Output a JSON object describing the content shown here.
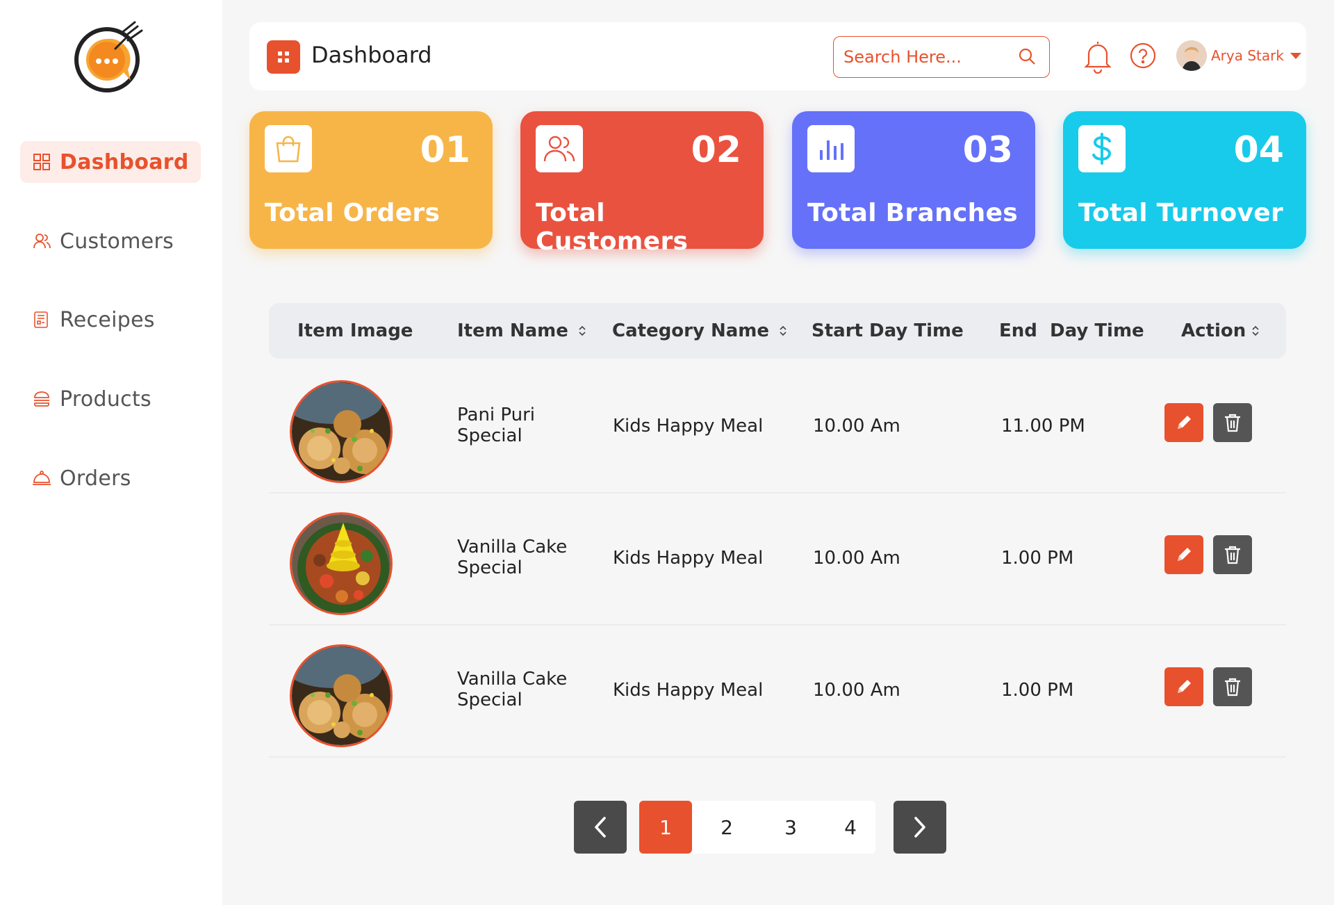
{
  "sidebar": {
    "items": [
      {
        "label": "Dashboard",
        "icon": "grid-icon"
      },
      {
        "label": "Customers",
        "icon": "users-icon"
      },
      {
        "label": "Receipes",
        "icon": "recipe-icon"
      },
      {
        "label": "Products",
        "icon": "burger-icon"
      },
      {
        "label": "Orders",
        "icon": "cloche-icon"
      }
    ],
    "active": "Dashboard"
  },
  "header": {
    "title": "Dashboard",
    "search_placeholder": "Search Here...",
    "user_name": "Arya Stark"
  },
  "cards": [
    {
      "number": "01",
      "label": "Total Orders",
      "color": "#f7b548",
      "icon": "shopping-bag-icon"
    },
    {
      "number": "02",
      "label": "Total Customers",
      "color": "#ea5240",
      "icon": "users-icon"
    },
    {
      "number": "03",
      "label": "Total Branches",
      "color": "#6571f9",
      "icon": "bar-chart-icon"
    },
    {
      "number": "04",
      "label": "Total Turnover",
      "color": "#18cbea",
      "icon": "dollar-icon"
    }
  ],
  "table": {
    "columns": [
      "Item Image",
      "Item Name",
      "Category Name",
      "Start Day Time",
      "End  Day Time",
      "Action"
    ],
    "rows": [
      {
        "name_line1": "Pani Puri",
        "name_line2": "Special",
        "category": "Kids Happy Meal",
        "start": "10.00 Am",
        "end": "11.00 PM",
        "image": "pani-puri"
      },
      {
        "name_line1": "Vanilla Cake",
        "name_line2": "Special",
        "category": "Kids Happy Meal",
        "start": "10.00 Am",
        "end": "1.00 PM",
        "image": "cake-platter"
      },
      {
        "name_line1": "Vanilla Cake",
        "name_line2": "Special",
        "category": "Kids Happy Meal",
        "start": "10.00 Am",
        "end": "1.00 PM",
        "image": "pani-puri"
      }
    ]
  },
  "pagination": {
    "pages": [
      "1",
      "2",
      "3",
      "4"
    ],
    "current": "1"
  },
  "colors": {
    "accent": "#e8512d",
    "dark": "#4a4a4a"
  }
}
